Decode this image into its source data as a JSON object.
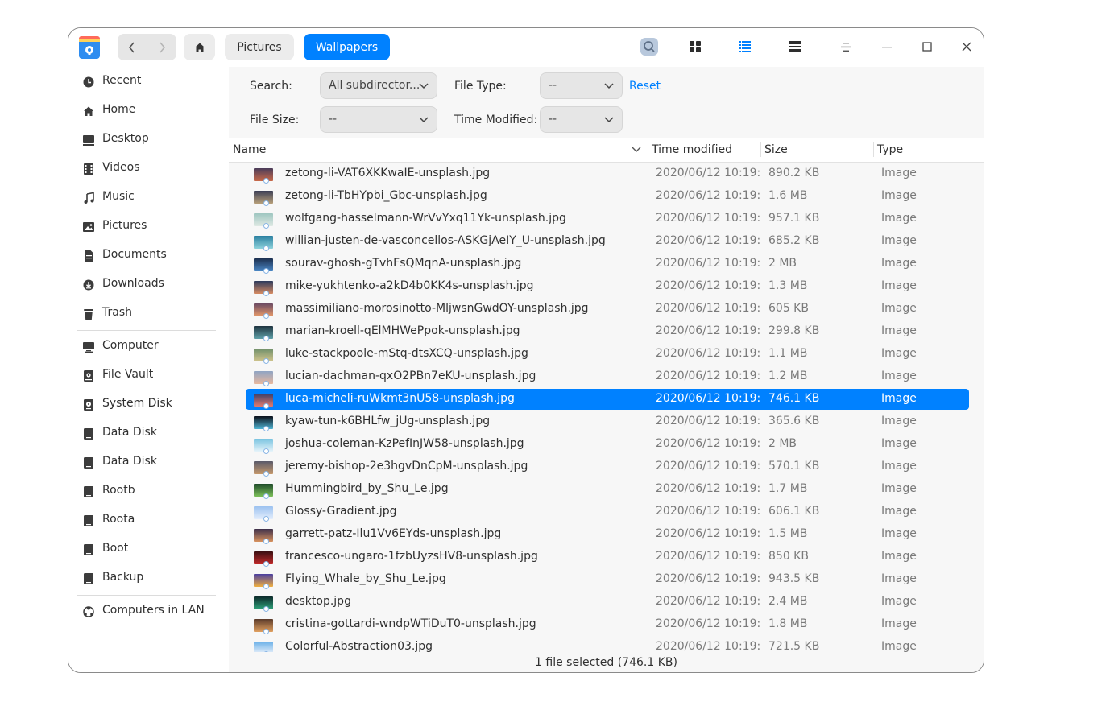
{
  "titlebar": {
    "breadcrumbs": [
      "Pictures",
      "Wallpapers"
    ],
    "icons": [
      "file-manager-app-icon",
      "back-icon",
      "forward-icon",
      "home-icon",
      "search-icon",
      "icon-view-icon",
      "list-view-icon",
      "tree-view-icon",
      "menu-icon",
      "minimize-icon",
      "maximize-icon",
      "close-icon"
    ],
    "accent_color": "#0081ff"
  },
  "sidebar": {
    "groups": [
      [
        {
          "label": "Recent",
          "icon": "clock-icon"
        },
        {
          "label": "Home",
          "icon": "home-icon"
        },
        {
          "label": "Desktop",
          "icon": "desktop-icon"
        },
        {
          "label": "Videos",
          "icon": "film-icon"
        },
        {
          "label": "Music",
          "icon": "music-note-icon"
        },
        {
          "label": "Pictures",
          "icon": "picture-icon"
        },
        {
          "label": "Documents",
          "icon": "document-icon"
        },
        {
          "label": "Downloads",
          "icon": "download-icon"
        },
        {
          "label": "Trash",
          "icon": "trash-icon"
        }
      ],
      [
        {
          "label": "Computer",
          "icon": "computer-icon"
        },
        {
          "label": "File Vault",
          "icon": "vault-icon"
        },
        {
          "label": "System Disk",
          "icon": "system-disk-icon"
        },
        {
          "label": "Data Disk",
          "icon": "disk-icon"
        },
        {
          "label": "Data Disk",
          "icon": "disk-icon"
        },
        {
          "label": "Rootb",
          "icon": "disk-icon"
        },
        {
          "label": "Roota",
          "icon": "disk-icon"
        },
        {
          "label": "Boot",
          "icon": "disk-icon"
        },
        {
          "label": "Backup",
          "icon": "disk-icon"
        }
      ],
      [
        {
          "label": "Computers in LAN",
          "icon": "network-icon"
        }
      ]
    ]
  },
  "filters": {
    "search_label": "Search:",
    "search_value": "All subdirector...",
    "file_type_label": "File Type:",
    "file_type_value": "--",
    "reset_label": "Reset",
    "file_size_label": "File Size:",
    "file_size_value": "--",
    "time_modified_label": "Time Modified:",
    "time_modified_value": "--"
  },
  "columns": {
    "name": "Name",
    "time": "Time modified",
    "size": "Size",
    "type": "Type"
  },
  "files": [
    {
      "name": "zetong-li-VAT6XKKwaIE-unsplash.jpg",
      "time": "2020/06/12 10:19:...",
      "size": "890.2 KB",
      "type": "Image",
      "thumb": [
        "#4a3c5a",
        "#c96a4a"
      ]
    },
    {
      "name": "zetong-li-TbHYpbi_Gbc-unsplash.jpg",
      "time": "2020/06/12 10:19:...",
      "size": "1.6 MB",
      "type": "Image",
      "thumb": [
        "#3a3e55",
        "#b8a07a"
      ]
    },
    {
      "name": "wolfgang-hasselmann-WrVvYxq11Yk-unsplash.jpg",
      "time": "2020/06/12 10:19:...",
      "size": "957.1 KB",
      "type": "Image",
      "thumb": [
        "#9ec6c0",
        "#dfe9e4"
      ]
    },
    {
      "name": "willian-justen-de-vasconcellos-ASKGjAeIY_U-unsplash.jpg",
      "time": "2020/06/12 10:19:...",
      "size": "685.2 KB",
      "type": "Image",
      "thumb": [
        "#2a7fa0",
        "#8fd3dc"
      ]
    },
    {
      "name": "sourav-ghosh-gTvhFsQMqnA-unsplash.jpg",
      "time": "2020/06/12 10:19:...",
      "size": "2 MB",
      "type": "Image",
      "thumb": [
        "#1c2f4f",
        "#4a86c4"
      ]
    },
    {
      "name": "mike-yukhtenko-a2kD4b0KK4s-unsplash.jpg",
      "time": "2020/06/12 10:19:...",
      "size": "1.3 MB",
      "type": "Image",
      "thumb": [
        "#2d3a5c",
        "#d78b62"
      ]
    },
    {
      "name": "massimiliano-morosinotto-MljwsnGwdOY-unsplash.jpg",
      "time": "2020/06/12 10:19:...",
      "size": "605 KB",
      "type": "Image",
      "thumb": [
        "#6b4a63",
        "#e89a6a"
      ]
    },
    {
      "name": "marian-kroell-qElMHWePpok-unsplash.jpg",
      "time": "2020/06/12 10:19:...",
      "size": "299.8 KB",
      "type": "Image",
      "thumb": [
        "#1f3440",
        "#5fa0a8"
      ]
    },
    {
      "name": "luke-stackpoole-mStq-dtsXCQ-unsplash.jpg",
      "time": "2020/06/12 10:19:...",
      "size": "1.1 MB",
      "type": "Image",
      "thumb": [
        "#6f8f6a",
        "#d2c58e"
      ]
    },
    {
      "name": "lucian-dachman-qxO2PBn7eKU-unsplash.jpg",
      "time": "2020/06/12 10:19:...",
      "size": "1.2 MB",
      "type": "Image",
      "thumb": [
        "#8fa4c4",
        "#e8b89e"
      ]
    },
    {
      "name": "luca-micheli-ruWkmt3nU58-unsplash.jpg",
      "time": "2020/06/12 10:19:...",
      "size": "746.1 KB",
      "type": "Image",
      "thumb": [
        "#3a3f6a",
        "#e27a6c"
      ],
      "selected": true
    },
    {
      "name": "kyaw-tun-k6BHLfw_jUg-unsplash.jpg",
      "time": "2020/06/12 10:19:...",
      "size": "365.6 KB",
      "type": "Image",
      "thumb": [
        "#0a0f1a",
        "#4fb3d1"
      ]
    },
    {
      "name": "joshua-coleman-KzPefInJW58-unsplash.jpg",
      "time": "2020/06/12 10:19:...",
      "size": "2 MB",
      "type": "Image",
      "thumb": [
        "#7ac4e0",
        "#e6f4fa"
      ]
    },
    {
      "name": "jeremy-bishop-2e3hgvDnCpM-unsplash.jpg",
      "time": "2020/06/12 10:19:...",
      "size": "570.1 KB",
      "type": "Image",
      "thumb": [
        "#5a5a6a",
        "#c79a6c"
      ]
    },
    {
      "name": "Hummingbird_by_Shu_Le.jpg",
      "time": "2020/06/12 10:19:...",
      "size": "1.7 MB",
      "type": "Image",
      "thumb": [
        "#1e4a2a",
        "#7cc05a"
      ]
    },
    {
      "name": "Glossy-Gradient.jpg",
      "time": "2020/06/12 10:19:...",
      "size": "606.1 KB",
      "type": "Image",
      "thumb": [
        "#9cc2f0",
        "#e4eefc"
      ]
    },
    {
      "name": "garrett-patz-Ilu1Vv6EYds-unsplash.jpg",
      "time": "2020/06/12 10:19:...",
      "size": "1.5 MB",
      "type": "Image",
      "thumb": [
        "#3c2f4a",
        "#d8925e"
      ]
    },
    {
      "name": "francesco-ungaro-1fzbUyzsHV8-unsplash.jpg",
      "time": "2020/06/12 10:19:...",
      "size": "850 KB",
      "type": "Image",
      "thumb": [
        "#3a0f12",
        "#c22a2a"
      ]
    },
    {
      "name": "Flying_Whale_by_Shu_Le.jpg",
      "time": "2020/06/12 10:19:...",
      "size": "943.5 KB",
      "type": "Image",
      "thumb": [
        "#4a3fa0",
        "#f0b040"
      ]
    },
    {
      "name": "desktop.jpg",
      "time": "2020/06/12 10:19:...",
      "size": "2.4 MB",
      "type": "Image",
      "thumb": [
        "#0d2a2a",
        "#2ea37a"
      ]
    },
    {
      "name": "cristina-gottardi-wndpWTiDuT0-unsplash.jpg",
      "time": "2020/06/12 10:19:...",
      "size": "1.8 MB",
      "type": "Image",
      "thumb": [
        "#5a3a2a",
        "#e0a060"
      ]
    },
    {
      "name": "Colorful-Abstraction03.jpg",
      "time": "2020/06/12 10:19:...",
      "size": "721.5 KB",
      "type": "Image",
      "thumb": [
        "#6ab0e8",
        "#f0f4fb"
      ]
    }
  ],
  "status": "1 file selected (746.1 KB)"
}
